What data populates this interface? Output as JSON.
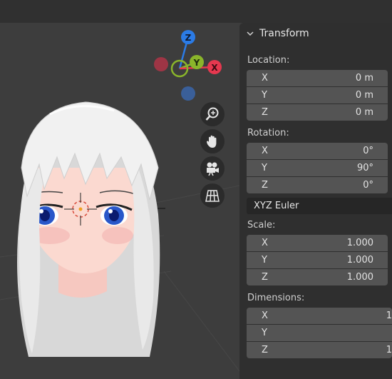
{
  "gizmo": {
    "z_label": "Z",
    "y_label": "Y",
    "x_label": "X",
    "colors": {
      "x": "#e6384f",
      "y": "#8ab52b",
      "z": "#2b7be6",
      "neg_x": "#9e3545",
      "neg_z": "#3a5f99"
    }
  },
  "nav_buttons": [
    {
      "name": "zoom-icon"
    },
    {
      "name": "hand-pan-icon"
    },
    {
      "name": "camera-icon"
    },
    {
      "name": "grid-ortho-icon"
    }
  ],
  "transform": {
    "title": "Transform",
    "location": {
      "label": "Location:",
      "x_label": "X",
      "x": "0 m",
      "y_label": "Y",
      "y": "0 m",
      "z_label": "Z",
      "z": "0 m"
    },
    "rotation": {
      "label": "Rotation:",
      "x_label": "X",
      "x": "0°",
      "y_label": "Y",
      "y": "90°",
      "z_label": "Z",
      "z": "0°",
      "mode": "XYZ Euler"
    },
    "scale": {
      "label": "Scale:",
      "x_label": "X",
      "x": "1.000",
      "y_label": "Y",
      "y": "1.000",
      "z_label": "Z",
      "z": "1.000"
    },
    "dimensions": {
      "label": "Dimensions:",
      "x_label": "X",
      "x": "1",
      "y_label": "Y",
      "y": "",
      "z_label": "Z",
      "z": "1"
    }
  }
}
